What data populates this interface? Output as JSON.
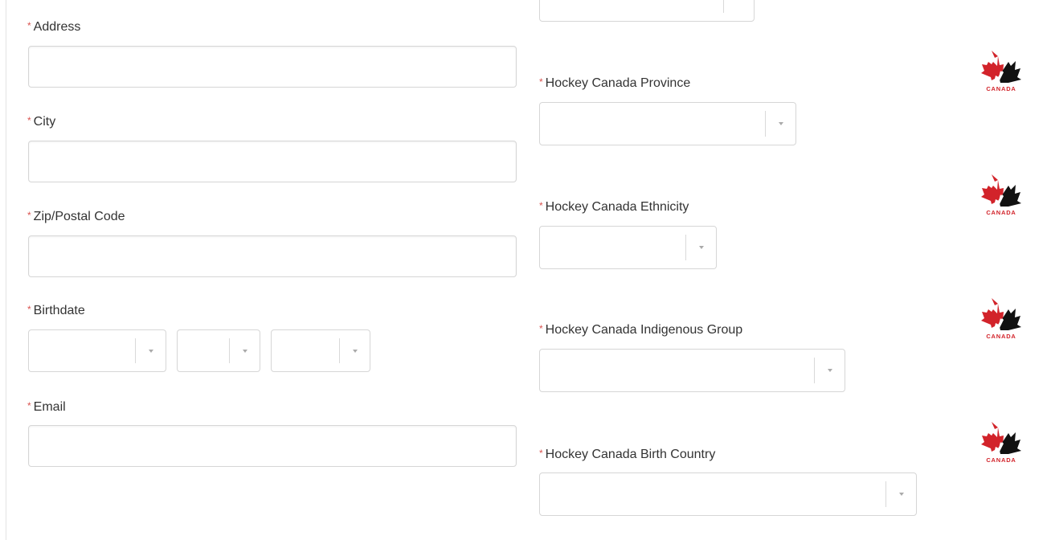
{
  "required_marker": "*",
  "left_form": {
    "address": {
      "label": "Address",
      "value": "",
      "placeholder": ""
    },
    "city": {
      "label": "City",
      "value": "",
      "placeholder": ""
    },
    "postal_code": {
      "label": "Zip/Postal Code",
      "value": "",
      "placeholder": ""
    },
    "birthdate": {
      "label": "Birthdate",
      "month": {
        "value": ""
      },
      "day": {
        "value": ""
      },
      "year": {
        "value": ""
      }
    },
    "email": {
      "label": "Email",
      "value": "",
      "placeholder": ""
    }
  },
  "right_form": {
    "top_select": {
      "value": ""
    },
    "province": {
      "label": "Hockey Canada Province",
      "value": "",
      "logo_text": "CANADA"
    },
    "ethnicity": {
      "label": "Hockey Canada Ethnicity",
      "value": "",
      "logo_text": "CANADA"
    },
    "indigenous_group": {
      "label": "Hockey Canada Indigenous Group",
      "value": "",
      "logo_text": "CANADA"
    },
    "birth_country": {
      "label": "Hockey Canada Birth Country",
      "value": "",
      "logo_text": "CANADA"
    }
  },
  "colors": {
    "required": "#d9534f",
    "border": "#d6d6d6",
    "logo_red": "#d2232a",
    "logo_black": "#111111"
  },
  "icons": {
    "select_caret": "chevron-down-icon",
    "brand_logo": "hockey-canada-logo"
  }
}
